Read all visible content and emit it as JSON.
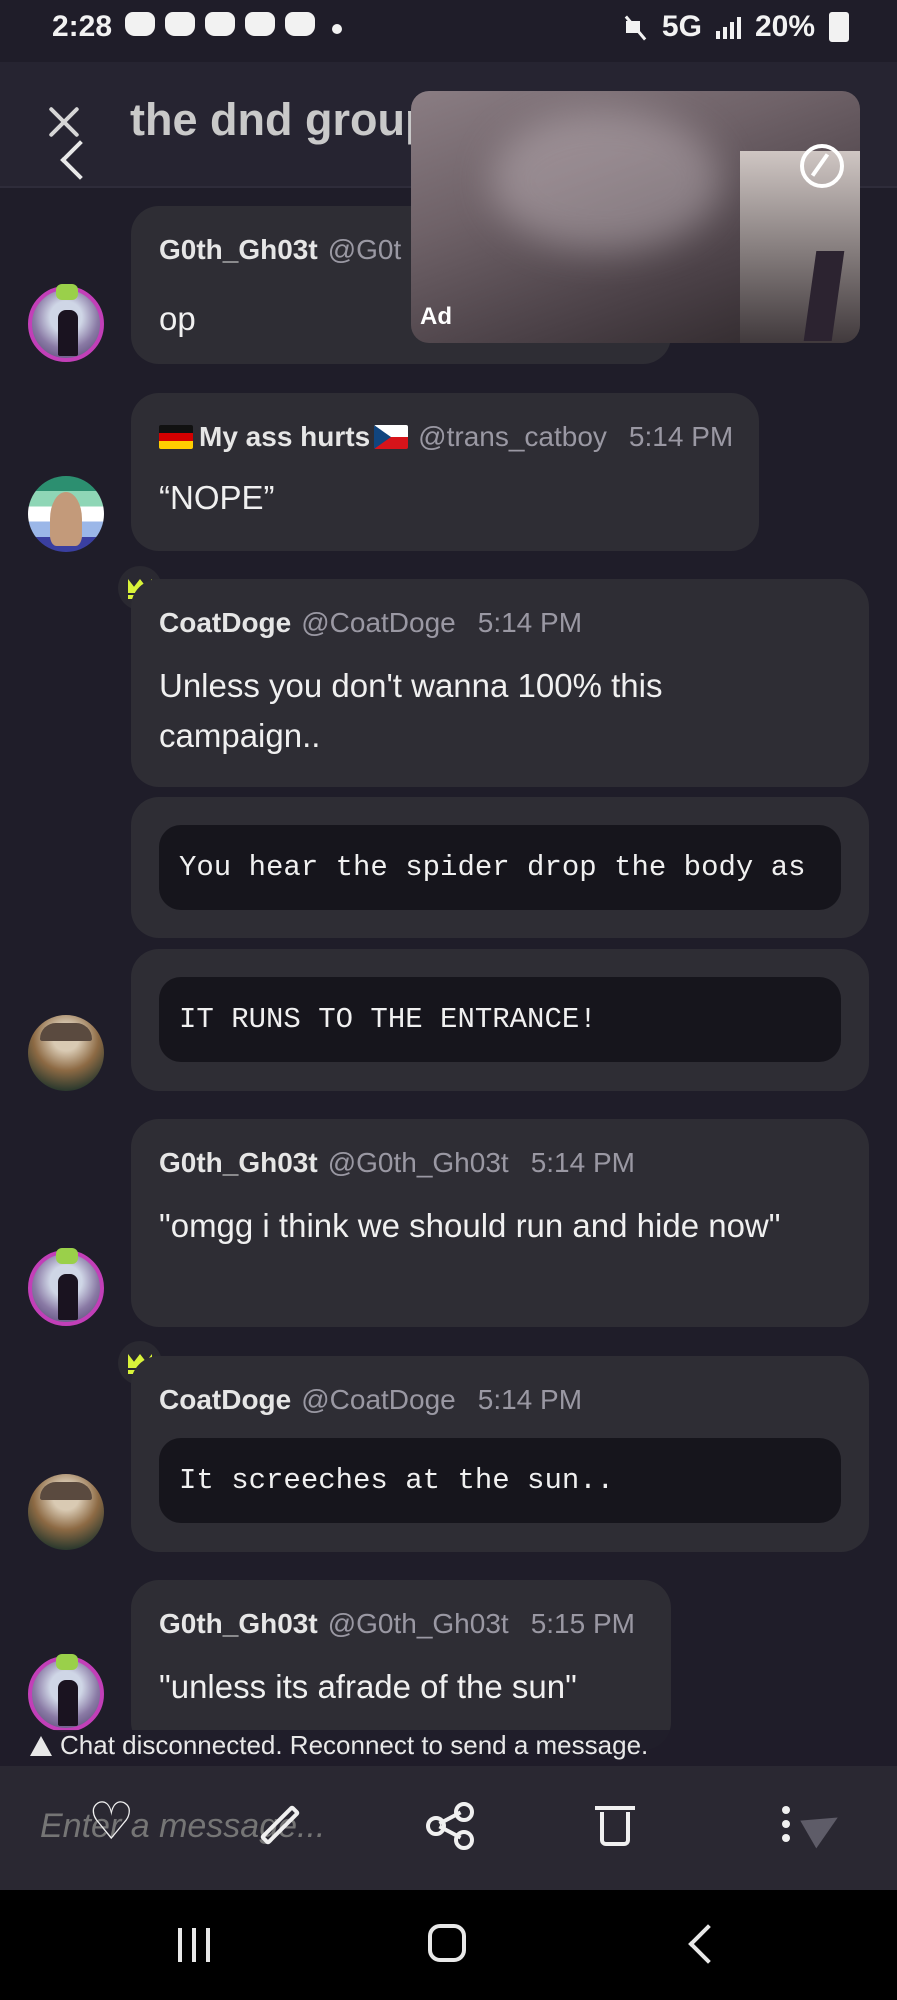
{
  "status_bar": {
    "time": "2:28",
    "battery": "20%",
    "network": "5G"
  },
  "header": {
    "title": "the dnd group"
  },
  "ad": {
    "label": "Ad"
  },
  "messages": [
    {
      "name": "G0th_Gh03t",
      "handle": "@G0t",
      "time": "",
      "text": "op"
    },
    {
      "name": "My ass hurts",
      "handle": "@trans_catboy",
      "time": "5:14 PM",
      "text": "“NOPE”"
    },
    {
      "name": "CoatDoge",
      "handle": "@CoatDoge",
      "time": "5:14 PM",
      "text": "Unless you don't wanna 100% this campaign.."
    },
    {
      "code": "You hear the spider drop the body as"
    },
    {
      "code": "IT RUNS TO THE ENTRANCE!"
    },
    {
      "name": "G0th_Gh03t",
      "handle": "@G0th_Gh03t",
      "time": "5:14 PM",
      "text": "\"omgg i think we should run and hide now\""
    },
    {
      "name": "CoatDoge",
      "handle": "@CoatDoge",
      "time": "5:14 PM",
      "code": "It screeches at the sun.."
    },
    {
      "name": "G0th_Gh03t",
      "handle": "@G0th_Gh03t",
      "time": "5:15 PM",
      "text": "\"unless its afrade of the sun\""
    }
  ],
  "notice": {
    "text": "Chat disconnected. Reconnect to send a message."
  },
  "composer": {
    "placeholder": "Enter a message..."
  },
  "icons": [
    "close-icon",
    "back-icon",
    "heart-icon",
    "pencil-icon",
    "share-icon",
    "trash-icon",
    "kebab-icon",
    "send-icon",
    "crown-icon",
    "warning-icon"
  ]
}
